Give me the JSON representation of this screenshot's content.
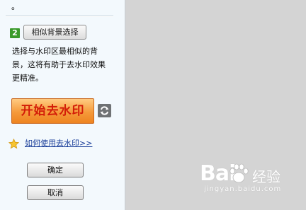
{
  "panel": {
    "top_mark": "。",
    "step_number": "2",
    "similar_bg_button": "相似背景选择",
    "description": "选择与水印区最相似的背景，这将有助于去水印效果更精准。",
    "start_button": "开始去水印",
    "refresh_icon": "refresh-icon",
    "star_icon": "star-icon",
    "howto_link": "如何使用去水印>>",
    "ok_button": "确定",
    "cancel_button": "取消"
  },
  "watermark": {
    "logo_text_left": "Bai",
    "logo_text_right": "经验",
    "url": "jingyan.baidu.com"
  },
  "colors": {
    "panel_bg": "#f3f9fd",
    "canvas_bg": "#d4d4d4",
    "start_button": "#f59a3a",
    "start_text": "#d31d08",
    "step_badge": "#3a9a2a",
    "link": "#1b3f9a"
  }
}
